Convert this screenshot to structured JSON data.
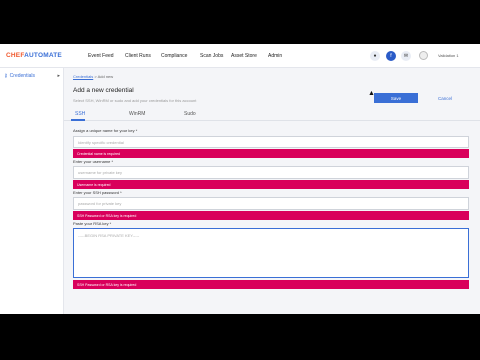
{
  "nav": {
    "logo_part1": "CHEF",
    "logo_part2": "AUTOMATE",
    "items": [
      "Event Feed",
      "Client Runs",
      "Compliance",
      "Scan Jobs",
      "Asset Store",
      "Admin"
    ],
    "icons": [
      "settings-icon",
      "chef-icon",
      "notification-icon"
    ],
    "user_name": "Validation 1"
  },
  "sidebar": {
    "item_label": "Credentials",
    "item_icon": "key-icon"
  },
  "breadcrumb": {
    "link": "Credentials",
    "separator": ">",
    "current": "Add new"
  },
  "header": {
    "title": "Add a new credential",
    "subtitle": "Select SSH, WinRM or sudo and add your credentials for this account",
    "save_label": "Save",
    "cancel_label": "Cancel"
  },
  "tabs": [
    "SSH",
    "WinRM",
    "Sudo"
  ],
  "form": {
    "name_label": "Assign a unique name for your key *",
    "name_placeholder": "Identify specific credential",
    "name_error": "Credential name is required",
    "username_label": "Enter your username *",
    "username_placeholder": "username for private key",
    "username_error": "Username is required",
    "password_label": "Enter your SSH password *",
    "password_placeholder": "password for private key",
    "password_error": "SSH Password or RSA key is required",
    "key_label": "Paste your RSA key *",
    "key_placeholder": "-----BEGIN RSA PRIVATE KEY-----",
    "key_error": "SSH Password or RSA key is required"
  },
  "colors": {
    "accent": "#3a6fd6",
    "error": "#d9005b",
    "brand_orange": "#f0582d"
  }
}
